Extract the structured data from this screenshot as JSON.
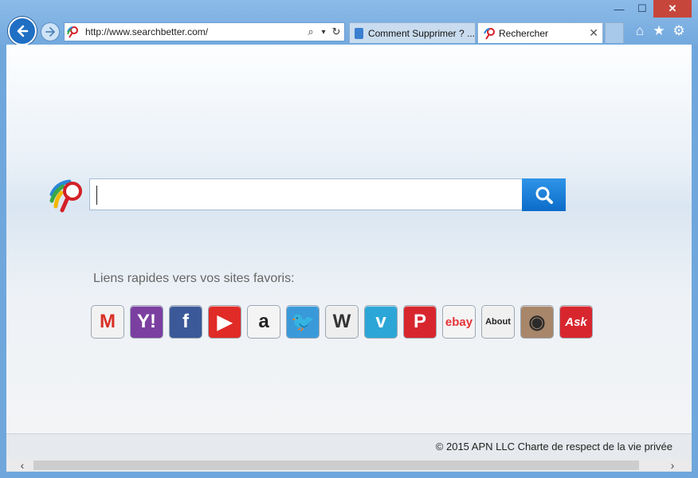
{
  "window": {
    "minimize_glyph": "—",
    "maximize_glyph": "☐",
    "close_glyph": "✕"
  },
  "nav": {
    "back_icon": "back-arrow-icon",
    "forward_icon": "forward-arrow-icon"
  },
  "address": {
    "url": "http://www.searchbetter.com/",
    "search_icon": "⌕",
    "dropdown_icon": "▾",
    "refresh_icon": "↻"
  },
  "tabs": [
    {
      "label": "Comment Supprimer ? ...",
      "active": false
    },
    {
      "label": "Rechercher",
      "active": true,
      "close_glyph": "✕"
    }
  ],
  "toolbar": {
    "home_glyph": "⌂",
    "favorites_glyph": "★",
    "tools_glyph": "⚙"
  },
  "search": {
    "value": "",
    "button_icon": "magnifier-icon"
  },
  "quicklinks": {
    "title": "Liens rapides vers vos sites favoris:",
    "items": [
      {
        "name": "gmail",
        "icon": "gmail-icon",
        "text": "M",
        "bg": "#f2f2f2",
        "fg": "#d93025"
      },
      {
        "name": "yahoo",
        "icon": "yahoo-icon",
        "text": "Y!",
        "bg": "#7b3fa0",
        "fg": "#ffffff"
      },
      {
        "name": "facebook",
        "icon": "facebook-icon",
        "text": "f",
        "bg": "#3b5998",
        "fg": "#ffffff"
      },
      {
        "name": "youtube",
        "icon": "youtube-icon",
        "text": "▶",
        "bg": "#e02b27",
        "fg": "#ffffff"
      },
      {
        "name": "amazon",
        "icon": "amazon-icon",
        "text": "a",
        "bg": "#f4f4f4",
        "fg": "#222222"
      },
      {
        "name": "twitter",
        "icon": "twitter-icon",
        "text": "🐦",
        "bg": "#3a9ad9",
        "fg": "#ffffff"
      },
      {
        "name": "wikipedia",
        "icon": "wikipedia-icon",
        "text": "W",
        "bg": "#eeeeee",
        "fg": "#333333"
      },
      {
        "name": "vimeo",
        "icon": "vimeo-icon",
        "text": "v",
        "bg": "#2ca6d6",
        "fg": "#ffffff"
      },
      {
        "name": "pinterest",
        "icon": "pinterest-icon",
        "text": "P",
        "bg": "#d8262e",
        "fg": "#ffffff"
      },
      {
        "name": "ebay",
        "icon": "ebay-icon",
        "text": "ebay",
        "bg": "#f4f4f4",
        "fg": "#e53238"
      },
      {
        "name": "about",
        "icon": "about-icon",
        "text": "About",
        "bg": "#f0f0f0",
        "fg": "#222222"
      },
      {
        "name": "instagram",
        "icon": "instagram-icon",
        "text": "◉",
        "bg": "#a8866a",
        "fg": "#2b2b2b"
      },
      {
        "name": "ask",
        "icon": "ask-icon",
        "text": "Ask",
        "bg": "#d8262e",
        "fg": "#ffffff"
      }
    ]
  },
  "footer": {
    "text": "© 2015 APN LLC  Charte de respect de la vie privée"
  },
  "scrollbar": {
    "left_glyph": "‹",
    "right_glyph": "›"
  },
  "colors": {
    "accent": "#1f6fc4",
    "search_button": "#0b6cc9"
  }
}
